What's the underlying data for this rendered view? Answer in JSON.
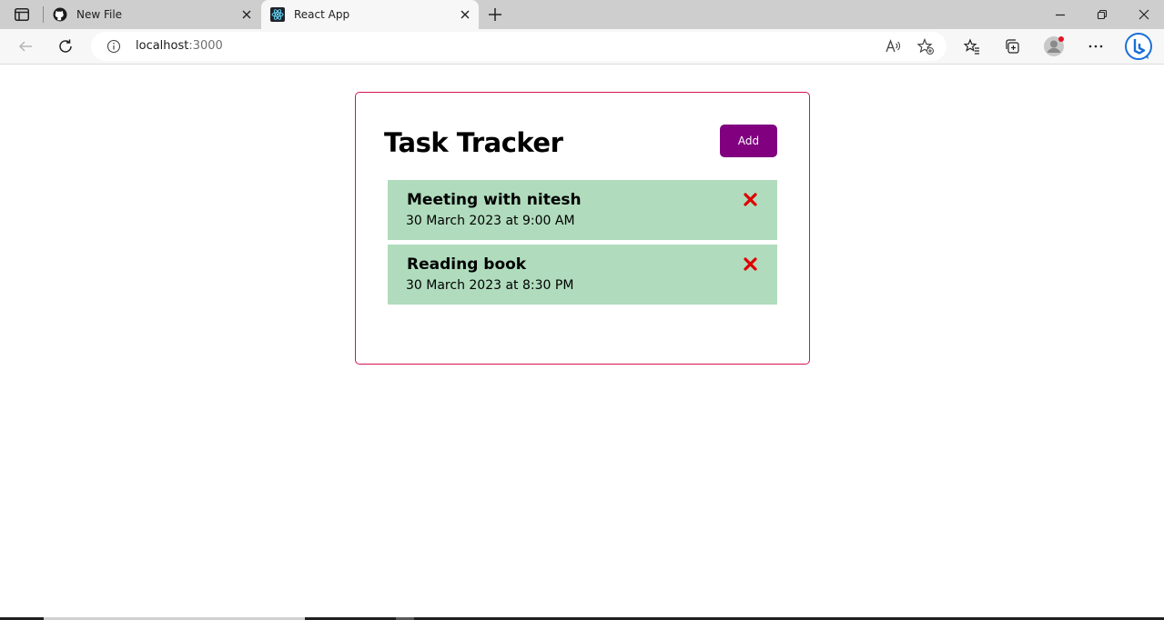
{
  "browser": {
    "tabs": [
      {
        "title": "New File",
        "favicon": "github-icon",
        "active": false
      },
      {
        "title": "React App",
        "favicon": "react-icon",
        "active": true
      }
    ],
    "address": {
      "host": "localhost",
      "port": ":3000"
    }
  },
  "app": {
    "title": "Task Tracker",
    "add_label": "Add",
    "colors": {
      "border": "#d6134f",
      "add_button": "#800080",
      "task_bg": "#b0dcbd",
      "delete_icon": "#e00000"
    },
    "tasks": [
      {
        "text": "Meeting with nitesh",
        "day": "30 March 2023 at 9:00 AM"
      },
      {
        "text": "Reading book",
        "day": "30 March 2023 at 8:30 PM"
      }
    ]
  }
}
